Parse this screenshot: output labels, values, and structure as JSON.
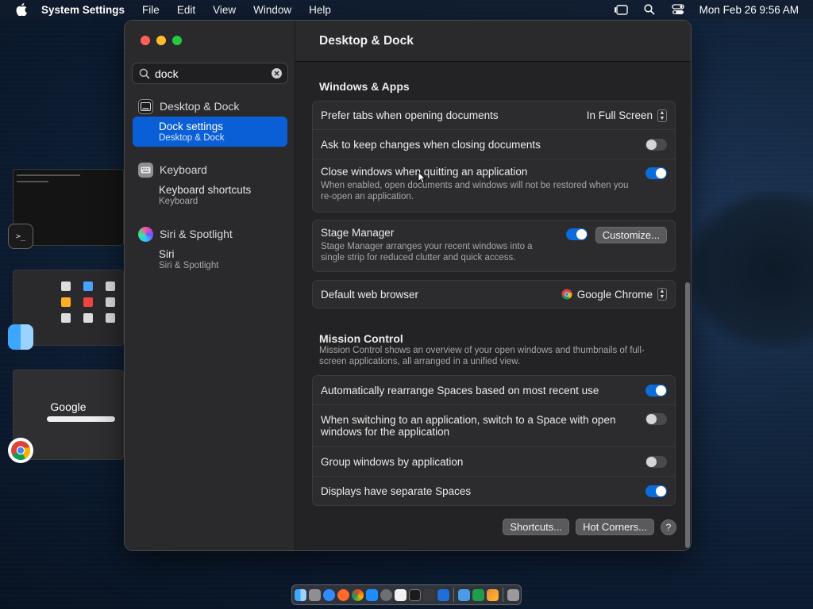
{
  "menubar": {
    "app_name": "System Settings",
    "menus": [
      "File",
      "Edit",
      "View",
      "Window",
      "Help"
    ],
    "clock": "Mon Feb 26  9:56 AM"
  },
  "window": {
    "title": "Desktop & Dock",
    "search": {
      "value": "dock",
      "placeholder": "Search"
    },
    "sidebar": [
      {
        "label": "Desktop & Dock",
        "sub_title": "Dock settings",
        "sub_caption": "Desktop & Dock",
        "active": true
      },
      {
        "label": "Keyboard",
        "sub_title": "Keyboard shortcuts",
        "sub_caption": "Keyboard",
        "active": false
      },
      {
        "label": "Siri & Spotlight",
        "sub_title": "Siri",
        "sub_caption": "Siri & Spotlight",
        "active": false
      }
    ],
    "windows_apps": {
      "title": "Windows & Apps",
      "prefer_tabs": {
        "label": "Prefer tabs when opening documents",
        "value": "In Full Screen"
      },
      "ask_keep": {
        "label": "Ask to keep changes when closing documents",
        "on": false
      },
      "close_windows": {
        "label": "Close windows when quitting an application",
        "desc": "When enabled, open documents and windows will not be restored when you re-open an application.",
        "on": true
      }
    },
    "stage_manager": {
      "label": "Stage Manager",
      "desc": "Stage Manager arranges your recent windows into a single strip for reduced clutter and quick access.",
      "on": true,
      "button": "Customize..."
    },
    "browser": {
      "label": "Default web browser",
      "value": "Google Chrome"
    },
    "mission_control": {
      "title": "Mission Control",
      "desc": "Mission Control shows an overview of your open windows and thumbnails of full-screen applications, all arranged in a unified view.",
      "rows": [
        {
          "label": "Automatically rearrange Spaces based on most recent use",
          "on": true
        },
        {
          "label": "When switching to an application, switch to a Space with open windows for the application",
          "on": false
        },
        {
          "label": "Group windows by application",
          "on": false
        },
        {
          "label": "Displays have separate Spaces",
          "on": true
        }
      ]
    },
    "footer": {
      "shortcuts": "Shortcuts...",
      "hot_corners": "Hot Corners...",
      "help": "?"
    }
  },
  "stage_strip": {
    "google_text": "Google",
    "terminal_glyph": ">_"
  },
  "colors": {
    "accent": "#0a6ddb",
    "selection": "#0a5fd6"
  }
}
